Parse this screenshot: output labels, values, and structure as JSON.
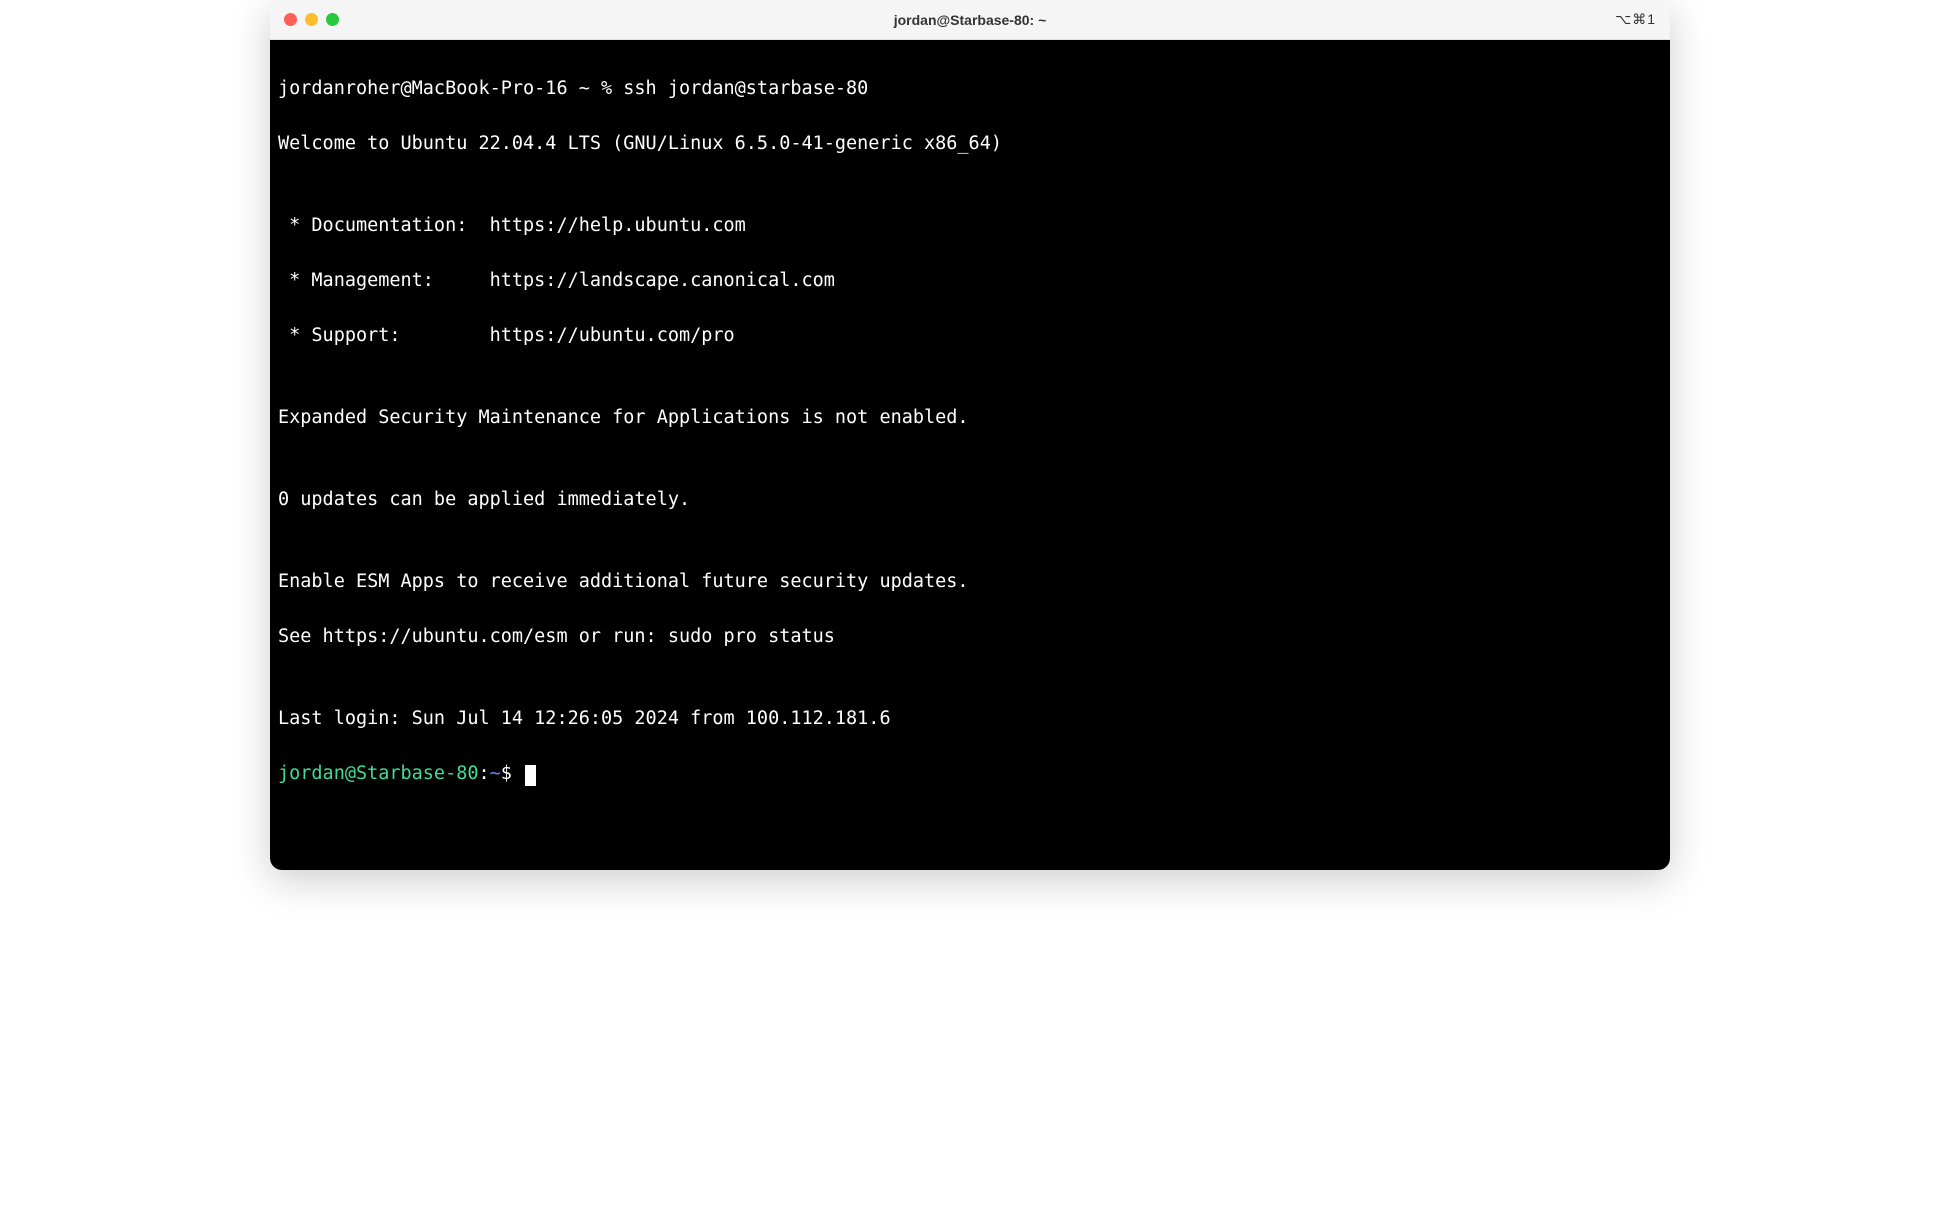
{
  "window": {
    "title": "jordan@Starbase-80: ~",
    "shortcut": "⌥⌘1"
  },
  "terminal": {
    "local_prompt": "jordanroher@MacBook-Pro-16 ~ % ",
    "local_command": "ssh jordan@starbase-80",
    "output": {
      "welcome": "Welcome to Ubuntu 22.04.4 LTS (GNU/Linux 6.5.0-41-generic x86_64)",
      "blank1": "",
      "doc_line": " * Documentation:  https://help.ubuntu.com",
      "mgmt_line": " * Management:     https://landscape.canonical.com",
      "support_line": " * Support:        https://ubuntu.com/pro",
      "blank2": "",
      "esm_notice": "Expanded Security Maintenance for Applications is not enabled.",
      "blank3": "",
      "updates": "0 updates can be applied immediately.",
      "blank4": "",
      "esm_enable": "Enable ESM Apps to receive additional future security updates.",
      "esm_see": "See https://ubuntu.com/esm or run: sudo pro status",
      "blank5": "",
      "last_login": "Last login: Sun Jul 14 12:26:05 2024 from 100.112.181.6"
    },
    "remote_prompt": {
      "user_host": "jordan@Starbase-80",
      "sep": ":",
      "path": "~",
      "symbol": "$ "
    }
  }
}
